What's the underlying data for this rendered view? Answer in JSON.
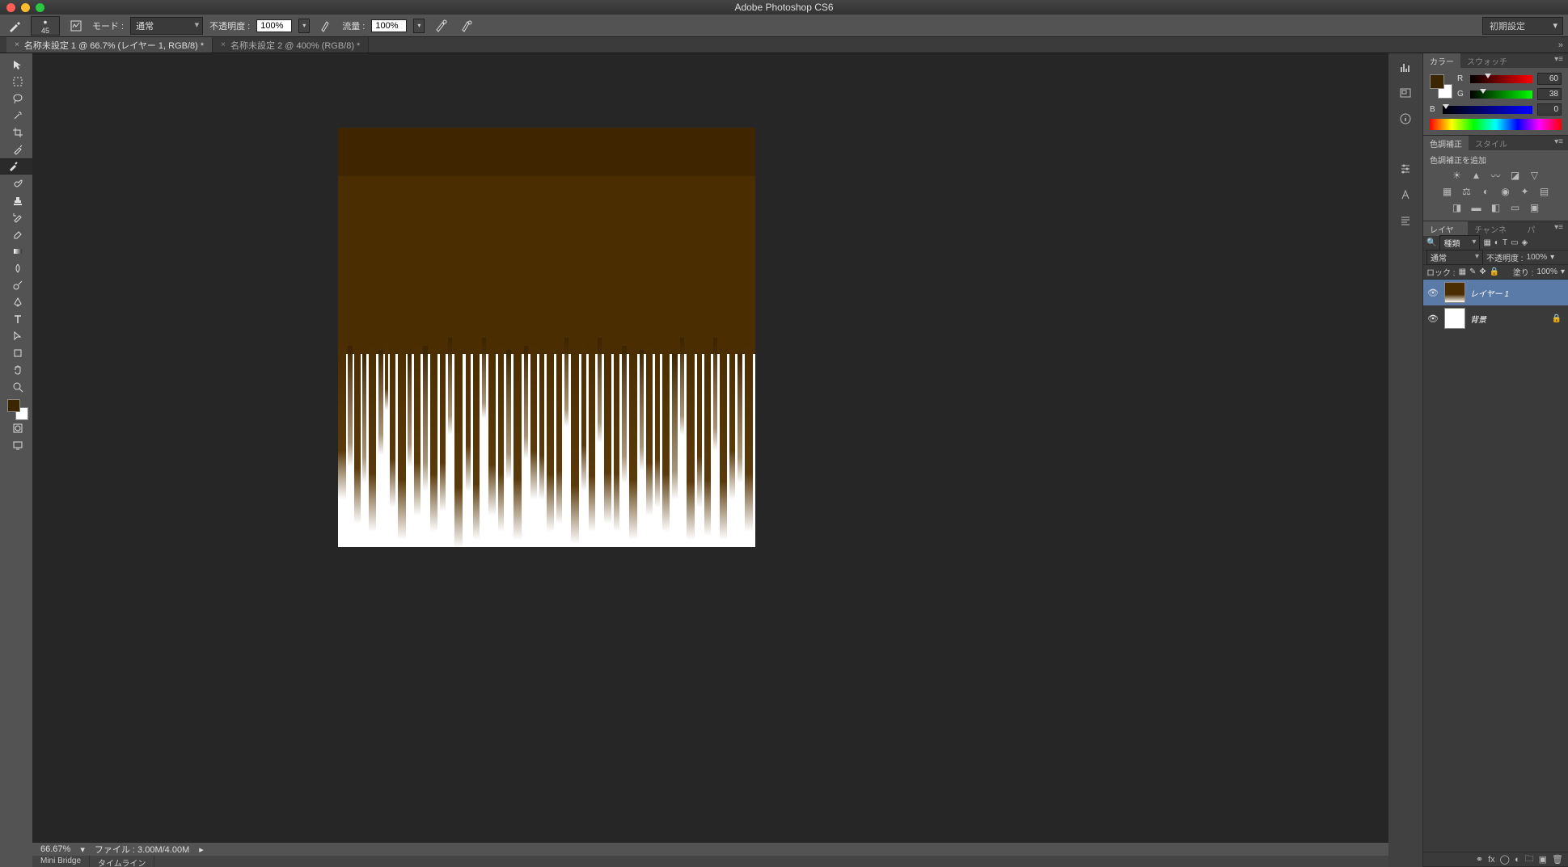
{
  "app": {
    "title": "Adobe Photoshop CS6"
  },
  "options": {
    "brush_size": "45",
    "mode_label": "モード :",
    "mode_value": "通常",
    "opacity_label": "不透明度 :",
    "opacity_value": "100%",
    "flow_label": "流量 :",
    "flow_value": "100%",
    "workspace": "初期設定"
  },
  "tabs": [
    {
      "label": "名称未設定 1 @ 66.7% (レイヤー 1, RGB/8) *",
      "active": true
    },
    {
      "label": "名称未設定 2 @ 400% (RGB/8) *",
      "active": false
    }
  ],
  "status": {
    "zoom": "66.67%",
    "file_label": "ファイル :",
    "file_value": "3.00M/4.00M"
  },
  "bottom_tabs": [
    "Mini Bridge",
    "タイムライン"
  ],
  "color": {
    "tab1": "カラー",
    "tab2": "スウォッチ",
    "r": 60,
    "g": 38,
    "b": 0,
    "fg": "#3c2600",
    "bg": "#ffffff"
  },
  "adjustments": {
    "tab1": "色調補正",
    "tab2": "スタイル",
    "add_label": "色調補正を追加"
  },
  "layers_panel": {
    "tab1": "レイヤー",
    "tab2": "チャンネル",
    "tab3": "パス",
    "kind": "種類",
    "blend": "通常",
    "opacity_label": "不透明度 :",
    "opacity": "100%",
    "lock_label": "ロック :",
    "fill_label": "塗り :",
    "fill": "100%",
    "layers": [
      {
        "name": "レイヤー 1",
        "locked": false,
        "active": true
      },
      {
        "name": "背景",
        "locked": true,
        "active": false
      }
    ]
  }
}
